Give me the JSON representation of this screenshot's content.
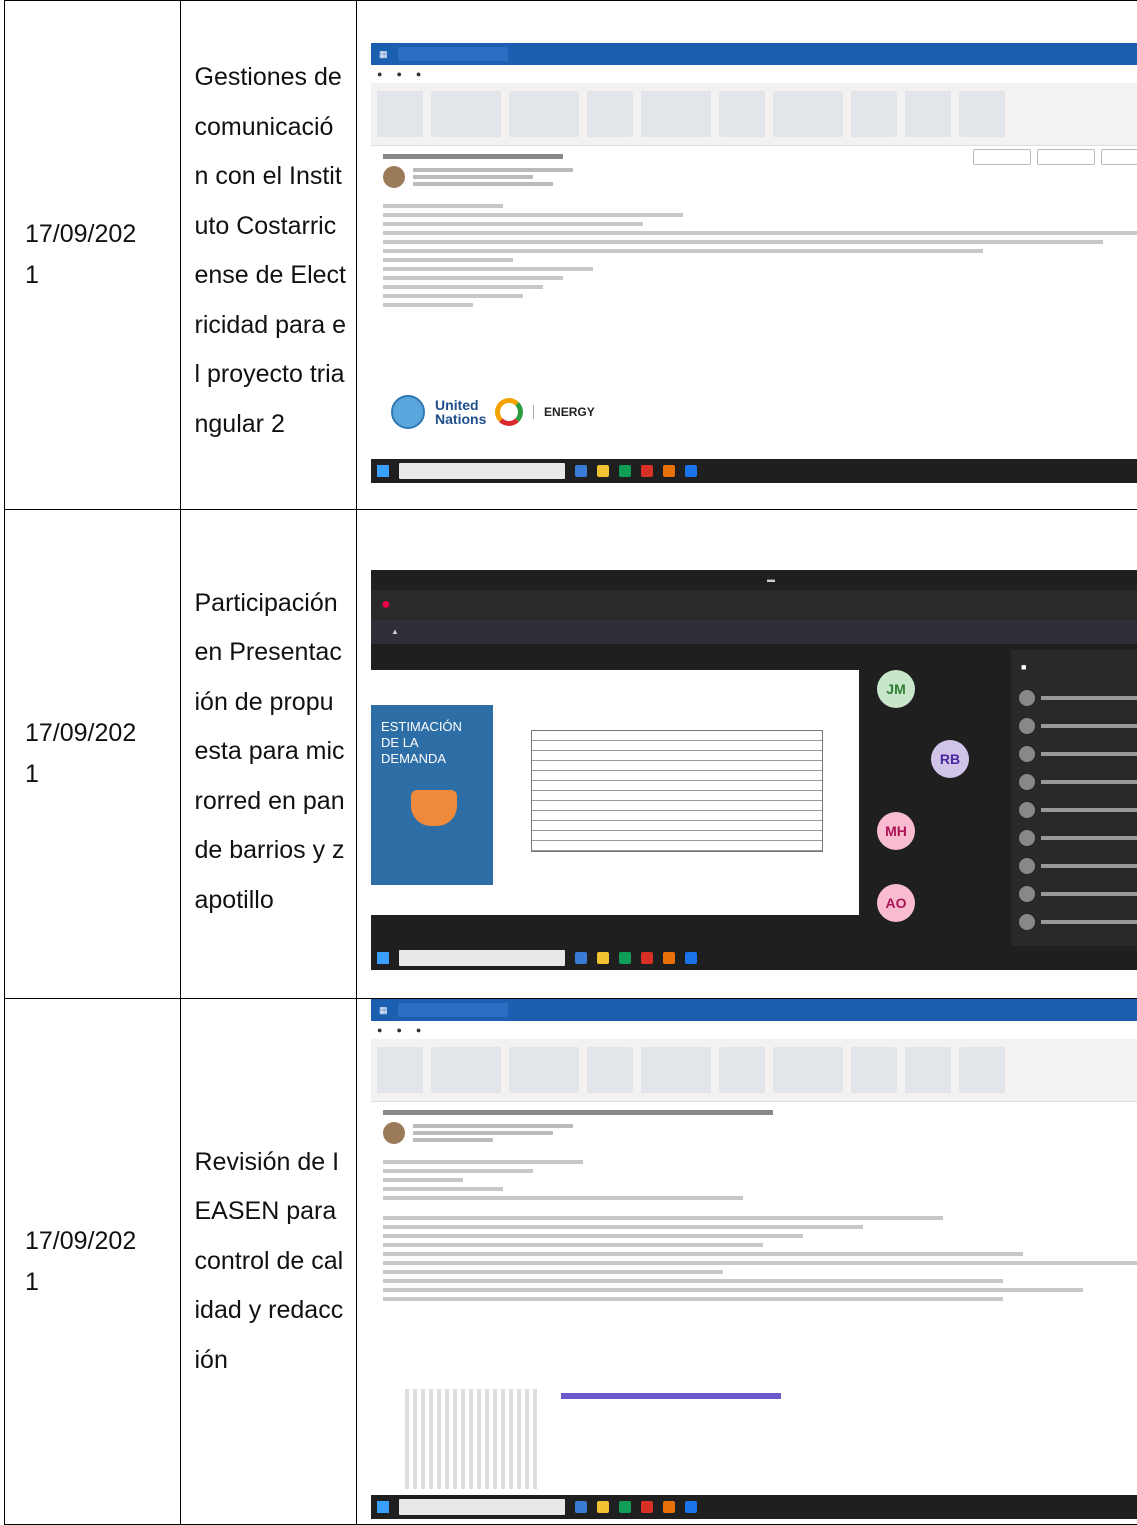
{
  "rows": [
    {
      "date": "17/09/2021",
      "activity": "Gestiones de comunicación con el Instituto Costarricense de Electricidad para el proyecto triangular 2",
      "screenshot": {
        "type": "outlook-email",
        "logo_un": "United Nations",
        "logo_energy": "ENERGY"
      }
    },
    {
      "date": "17/09/2021",
      "activity": "Participación en Presentación de propuesta para microrred en pan de barrios y zapotillo",
      "screenshot": {
        "type": "teams-meeting",
        "slide_title": "ESTIMACIÓN DE LA DEMANDA",
        "participants": [
          "JM",
          "RB",
          "MH",
          "AO"
        ]
      }
    },
    {
      "date": "17/09/2021",
      "activity": "Revisión de IEASEN para control de calidad y redacción",
      "screenshot": {
        "type": "outlook-email"
      }
    }
  ],
  "colors": {
    "border": "#000000",
    "text": "#111111"
  }
}
